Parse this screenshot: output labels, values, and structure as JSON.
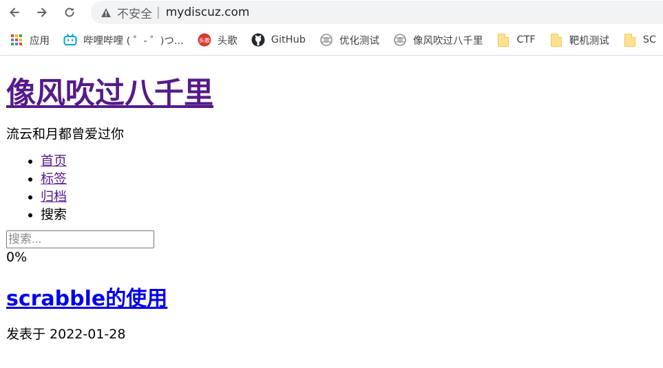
{
  "browser": {
    "insecure_label": "不安全",
    "separator": "|",
    "url": "mydiscuz.com",
    "bookmarks": [
      {
        "label": "应用",
        "icon": "apps-grid-icon"
      },
      {
        "label": "哔哩哔哩 ( ゜- ゜)つ...",
        "icon": "bilibili-icon"
      },
      {
        "label": "头歌",
        "icon": "touge-icon"
      },
      {
        "label": "GitHub",
        "icon": "github-icon"
      },
      {
        "label": "优化测试",
        "icon": "globe-icon"
      },
      {
        "label": "像风吹过八千里",
        "icon": "globe-icon"
      },
      {
        "label": "CTF",
        "icon": "folder-icon"
      },
      {
        "label": "靶机测试",
        "icon": "folder-icon"
      },
      {
        "label": "SC",
        "icon": "folder-icon"
      }
    ],
    "colors": {
      "bilibili": "#00a1d6",
      "touge": "#d83b2f",
      "folder": "#fde293"
    }
  },
  "page": {
    "site_title": "像风吹过八千里",
    "subtitle": "流云和月都曾爱过你",
    "menu": [
      "首页",
      "标签",
      "归档",
      "搜索"
    ],
    "search_placeholder": "搜索...",
    "progress": "0%",
    "post_title": "scrabble的使用",
    "post_meta": "发表于 2022-01-28"
  }
}
